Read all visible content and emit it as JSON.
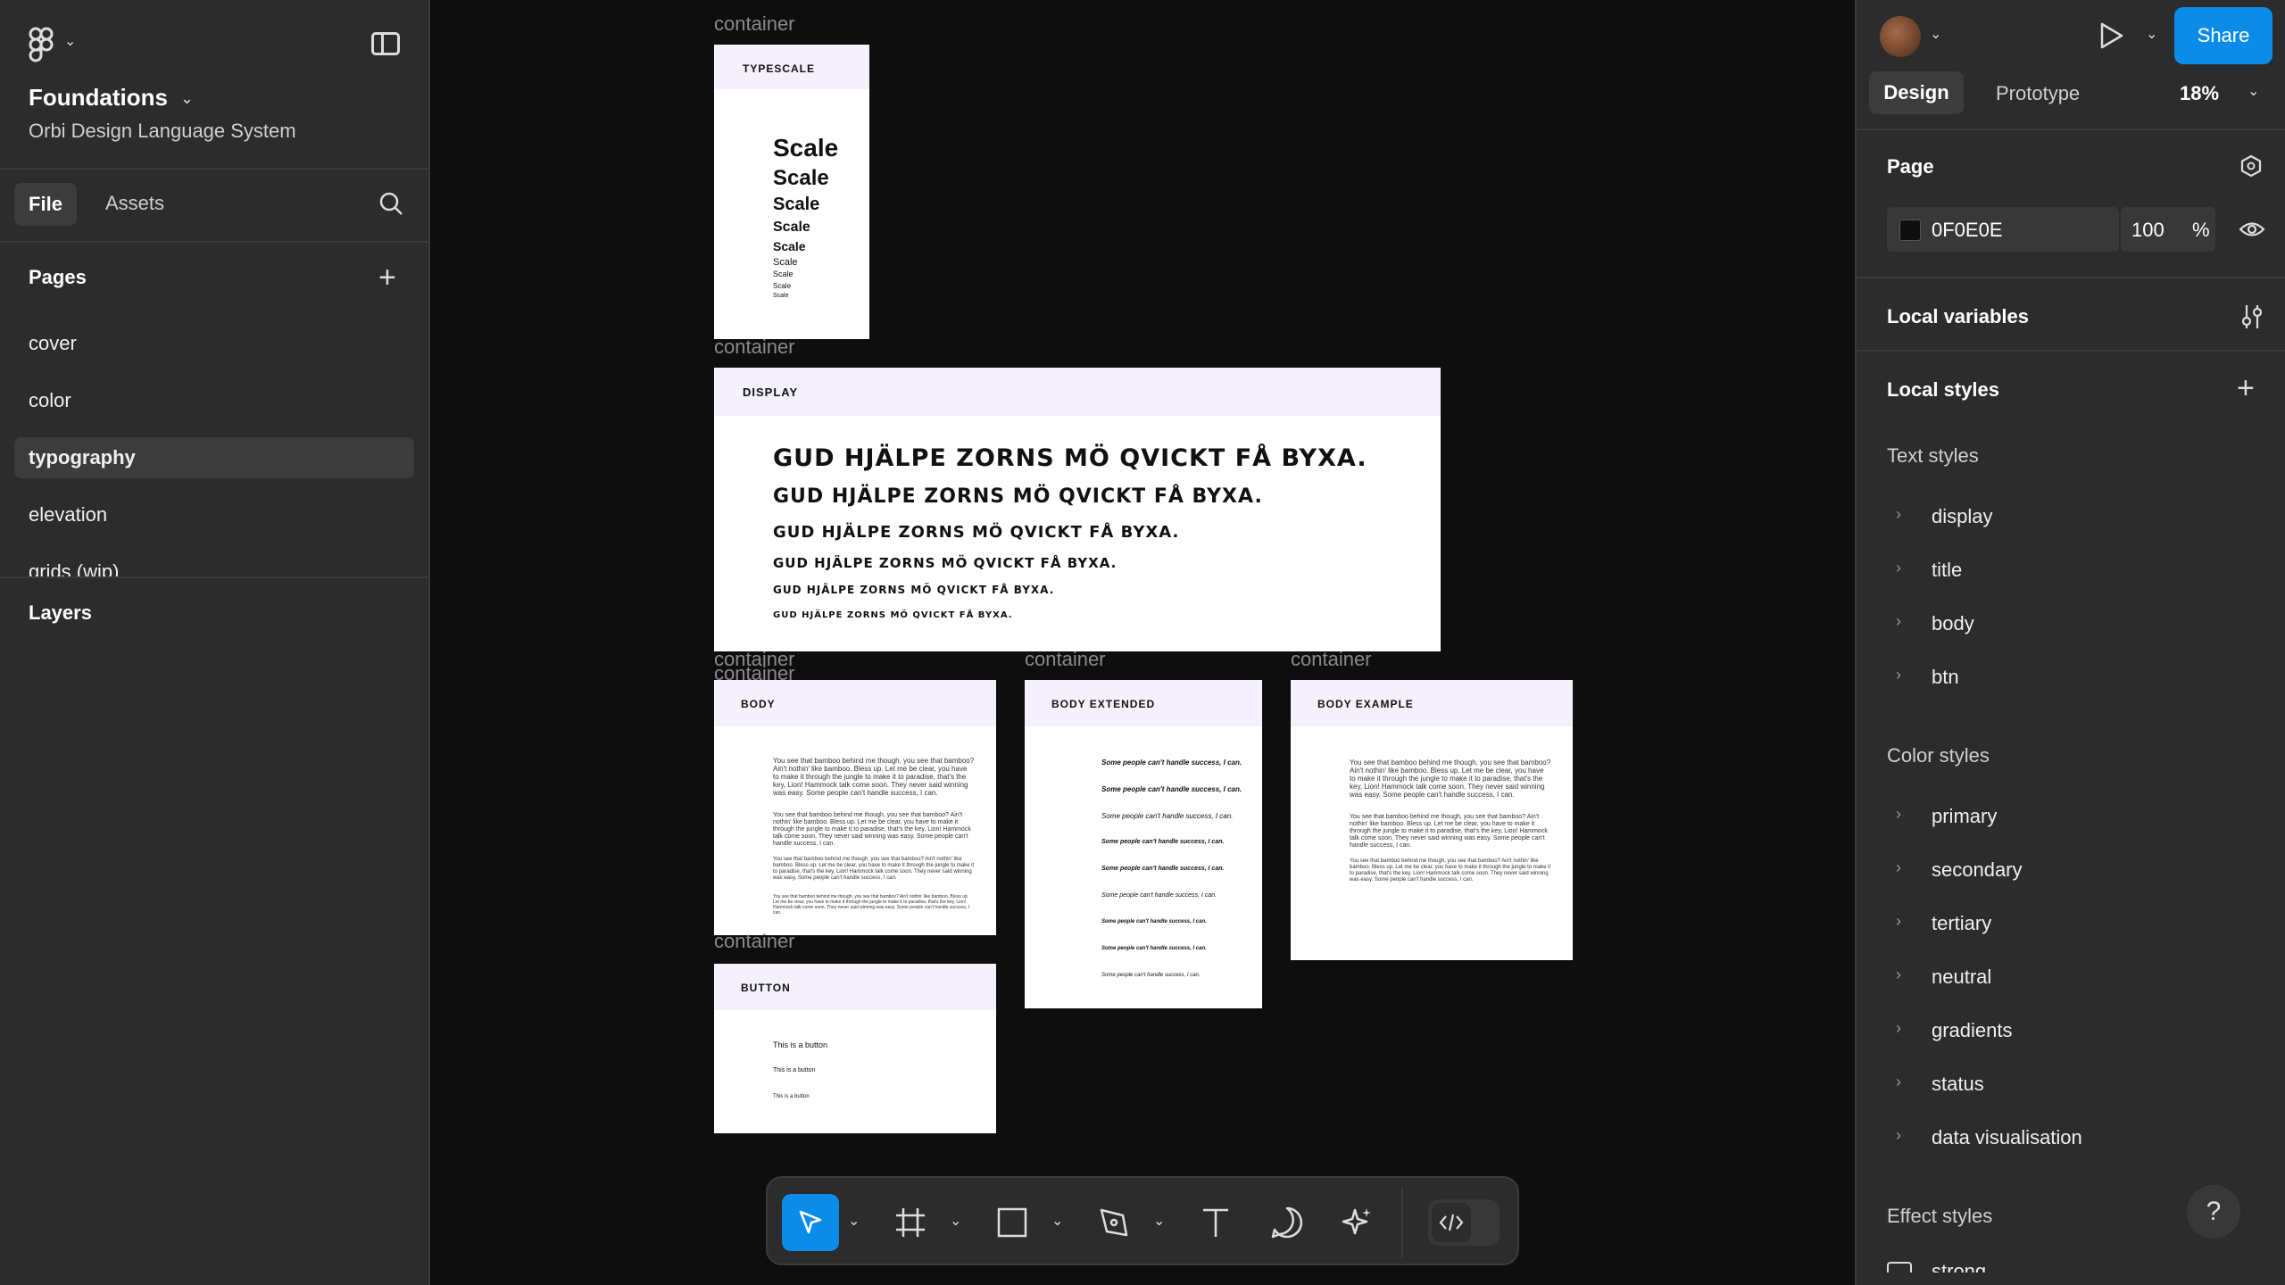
{
  "file": {
    "title": "Foundations",
    "subtitle": "Orbi Design Language System"
  },
  "left": {
    "tabs": {
      "file": "File",
      "assets": "Assets"
    },
    "pages_label": "Pages",
    "pages": [
      "cover",
      "color",
      "typography",
      "elevation",
      "grids (wip)"
    ],
    "active_page": "typography",
    "layers_label": "Layers"
  },
  "right": {
    "share": "Share",
    "tabs": {
      "design": "Design",
      "prototype": "Prototype"
    },
    "zoom": "18%",
    "page_label": "Page",
    "page_color": "0F0E0E",
    "page_opacity": "100",
    "percent": "%",
    "local_variables": "Local variables",
    "local_styles": "Local styles",
    "text_styles_label": "Text styles",
    "text_styles": [
      "display",
      "title",
      "body",
      "btn"
    ],
    "color_styles_label": "Color styles",
    "color_styles": [
      "primary",
      "secondary",
      "tertiary",
      "neutral",
      "gradients",
      "status",
      "data visualisation"
    ],
    "effect_styles_label": "Effect styles",
    "effect_partial": "strong",
    "help": "?"
  },
  "canvas": {
    "container_label": "container",
    "typescale": {
      "head": "TYPESCALE",
      "word": "Scale"
    },
    "display": {
      "head": "DISPLAY",
      "sentence": "GUD HJÄLPE ZORNS MÖ QVICKT FÅ BYXA."
    },
    "body": {
      "head": "BODY",
      "para": "You see that bamboo behind me though, you see that bamboo? Ain't nothin' like bamboo. Bless up. Let me be clear, you have to make it through the jungle to make it to paradise, that's the key, Lion! Hammock talk come soon. They never said winning was easy. Some people can't handle success, I can."
    },
    "body_extended": {
      "head": "BODY EXTENDED",
      "line": "Some people can't handle success, I can."
    },
    "body_example": {
      "head": "BODY EXAMPLE"
    },
    "button": {
      "head": "BUTTON",
      "line": "This is a button"
    }
  },
  "colors": {
    "accent": "#0c8ce9",
    "canvas": "#0f0e0e",
    "panel": "#2c2c2c",
    "frame_header": "#f4f0fc"
  }
}
